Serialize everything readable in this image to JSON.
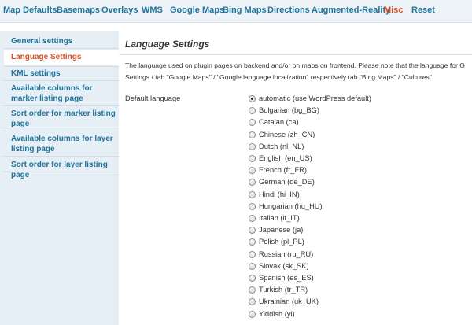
{
  "topnav": {
    "tabs": [
      {
        "label": "Map Defaults",
        "active": false
      },
      {
        "label": "Basemaps",
        "active": false
      },
      {
        "label": "Overlays",
        "active": false
      },
      {
        "label": "WMS",
        "active": false
      },
      {
        "label": "Google Maps",
        "active": false
      },
      {
        "label": "Bing Maps",
        "active": false
      },
      {
        "label": "Directions",
        "active": false
      },
      {
        "label": "Augmented-Reality",
        "active": false
      },
      {
        "label": "Misc",
        "active": true
      },
      {
        "label": "Reset",
        "active": false
      }
    ]
  },
  "sidebar": {
    "items": [
      {
        "label": "General settings"
      },
      {
        "label": "Language Settings",
        "active": true
      },
      {
        "label": "KML settings"
      },
      {
        "label": "Available columns for marker listing page"
      },
      {
        "label": "Sort order for marker listing page"
      },
      {
        "label": "Available columns for layer listing page"
      },
      {
        "label": "Sort order for layer listing page"
      }
    ]
  },
  "main": {
    "heading": "Language Settings",
    "description_line1": "The language used on plugin pages on backend and/or on maps on frontend. Please note that the language for G",
    "description_line2": "Settings / tab \"Google Maps\" / \"Google language localization\" respectively tab \"Bing Maps\" / \"Cultures\"",
    "field_label": "Default language",
    "options": [
      {
        "label": "automatic (use WordPress default)",
        "checked": true
      },
      {
        "label": "Bulgarian (bg_BG)"
      },
      {
        "label": "Catalan (ca)"
      },
      {
        "label": "Chinese (zh_CN)"
      },
      {
        "label": "Dutch (nl_NL)"
      },
      {
        "label": "English (en_US)"
      },
      {
        "label": "French (fr_FR)"
      },
      {
        "label": "German (de_DE)"
      },
      {
        "label": "Hindi (hi_IN)"
      },
      {
        "label": "Hungarian (hu_HU)"
      },
      {
        "label": "Italian (it_IT)"
      },
      {
        "label": "Japanese (ja)"
      },
      {
        "label": "Polish (pl_PL)"
      },
      {
        "label": "Russian (ru_RU)"
      },
      {
        "label": "Slovak (sk_SK)"
      },
      {
        "label": "Spanish (es_ES)"
      },
      {
        "label": "Turkish (tr_TR)"
      },
      {
        "label": "Ukrainian (uk_UK)"
      },
      {
        "label": "Yiddish (yi)"
      }
    ]
  },
  "colors": {
    "link": "#21759b",
    "active": "#d54e21",
    "sidebar_bg": "#e6eef6",
    "topnav_bg": "#eef3f8"
  }
}
